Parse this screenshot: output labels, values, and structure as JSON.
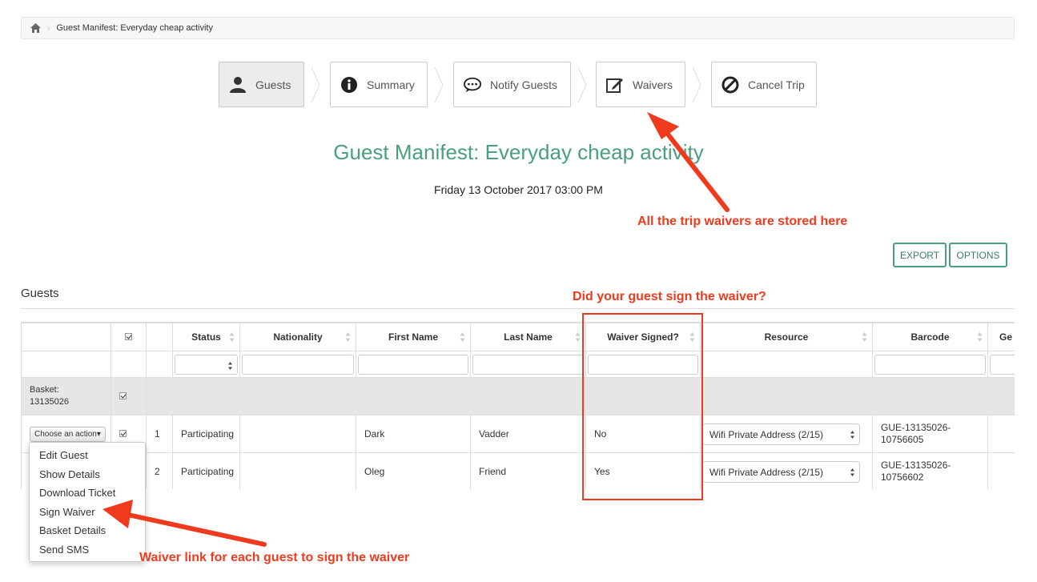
{
  "breadcrumb": {
    "current": "Guest Manifest: Everyday cheap activity"
  },
  "steps": [
    {
      "label": "Guests",
      "icon": "user-icon",
      "active": true
    },
    {
      "label": "Summary",
      "icon": "info-icon"
    },
    {
      "label": "Notify Guests",
      "icon": "chat-icon"
    },
    {
      "label": "Waivers",
      "icon": "edit-icon"
    },
    {
      "label": "Cancel Trip",
      "icon": "ban-icon"
    }
  ],
  "page": {
    "title": "Guest Manifest: Everyday cheap activity",
    "date": "Friday 13 October 2017 03:00 PM",
    "export_label": "EXPORT",
    "options_label": "OPTIONS",
    "section_title": "Guests"
  },
  "table": {
    "headers": [
      "Status",
      "Nationality",
      "First Name",
      "Last Name",
      "Waiver Signed?",
      "Resource",
      "Barcode",
      "Ge"
    ],
    "basket_label": "Basket:",
    "basket_id": "13135026",
    "choose_action": "Choose an action",
    "rows": [
      {
        "num": "1",
        "status": "Participating",
        "nationality": "",
        "first": "Dark",
        "last": "Vadder",
        "waiver": "No",
        "resource": "Wifi Private Address (2/15)",
        "barcode1": "GUE-13135026-",
        "barcode2": "10756605"
      },
      {
        "num": "2",
        "status": "Participating",
        "nationality": "",
        "first": "Oleg",
        "last": "Friend",
        "waiver": "Yes",
        "resource": "Wifi Private Address (2/15)",
        "barcode1": "GUE-13135026-",
        "barcode2": "10756602"
      }
    ]
  },
  "menu": [
    "Edit Guest",
    "Show Details",
    "Download Ticket",
    "Sign Waiver",
    "Basket Details",
    "Send SMS"
  ],
  "annotations": {
    "waivers_stored": "All the trip waivers are stored here",
    "did_sign": "Did your guest sign the waiver?",
    "waiver_link": "Waiver link for each guest to sign the waiver"
  },
  "colors": {
    "accent": "#4aa07a",
    "annotation": "#ef3a1e"
  }
}
